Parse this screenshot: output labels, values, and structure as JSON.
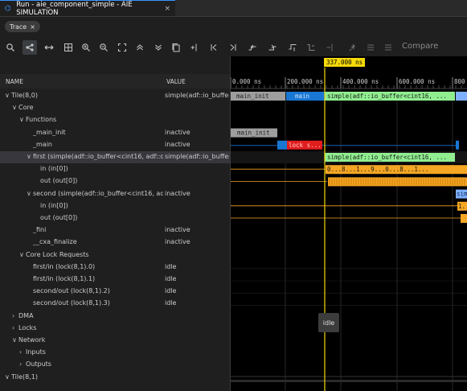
{
  "window": {
    "tab_title": "Run - aie_component_simple - AIE SIMULATION",
    "close_glyph": "×"
  },
  "chip": {
    "label": "Trace",
    "close_glyph": "×"
  },
  "toolbar": {
    "compare_label": "Compare"
  },
  "columns": {
    "name": "NAME",
    "value": "VALUE"
  },
  "tree": [
    {
      "name": "Tile(8,0)",
      "value": "simple(adf::io_buffer",
      "indent": 0,
      "chev": "∨"
    },
    {
      "name": "Core",
      "value": "",
      "indent": 1,
      "chev": "∨"
    },
    {
      "name": "Functions",
      "value": "",
      "indent": 2,
      "chev": "∨"
    },
    {
      "name": "_main_init",
      "value": "inactive",
      "indent": 3,
      "chev": ""
    },
    {
      "name": "_main",
      "value": "inactive",
      "indent": 3,
      "chev": ""
    },
    {
      "name": "first (simple(adf::io_buffer<cint16, adf::dire",
      "value": "simple(adf::io_buffer",
      "indent": 3,
      "chev": "∨",
      "selected": true
    },
    {
      "name": "in (in[0])",
      "value": "",
      "indent": 4,
      "chev": ""
    },
    {
      "name": "out (out[0])",
      "value": "",
      "indent": 4,
      "chev": ""
    },
    {
      "name": "second (simple(adf::io_buffer<cint16, adf::",
      "value": "inactive",
      "indent": 3,
      "chev": "∨"
    },
    {
      "name": "in (in[0])",
      "value": "",
      "indent": 4,
      "chev": ""
    },
    {
      "name": "out (out[0])",
      "value": "",
      "indent": 4,
      "chev": ""
    },
    {
      "name": "_fini",
      "value": "inactive",
      "indent": 3,
      "chev": ""
    },
    {
      "name": "__cxa_finalize",
      "value": "inactive",
      "indent": 3,
      "chev": ""
    },
    {
      "name": "Core Lock Requests",
      "value": "",
      "indent": 2,
      "chev": "∨"
    },
    {
      "name": "first/in (lock(8,1).0)",
      "value": "idle",
      "indent": 3,
      "chev": ""
    },
    {
      "name": "first/in (lock(8,1).1)",
      "value": "idle",
      "indent": 3,
      "chev": ""
    },
    {
      "name": "second/out (lock(8,1).2)",
      "value": "idle",
      "indent": 3,
      "chev": ""
    },
    {
      "name": "second/out (lock(8,1).3)",
      "value": "idle",
      "indent": 3,
      "chev": ""
    },
    {
      "name": "DMA",
      "value": "",
      "indent": 1,
      "chev": "›"
    },
    {
      "name": "Locks",
      "value": "",
      "indent": 1,
      "chev": "›"
    },
    {
      "name": "Network",
      "value": "",
      "indent": 1,
      "chev": "∨"
    },
    {
      "name": "Inputs",
      "value": "",
      "indent": 2,
      "chev": "›"
    },
    {
      "name": "Outputs",
      "value": "",
      "indent": 2,
      "chev": "›"
    },
    {
      "name": "Tile(8,1)",
      "value": "",
      "indent": 0,
      "chev": "∨"
    }
  ],
  "timeline": {
    "cursor_label": "337.000 ns",
    "ticks": [
      "0.000 ns",
      "200.000 ns",
      "400.000 ns",
      "600.000 ns",
      "800"
    ],
    "labels": {
      "main_init": "main_init",
      "main": "main",
      "simple": "simple(adf::io_buffer<cint16, ...",
      "lock": "lock s...",
      "in_data": "0...8...1...9...0...8...1...",
      "sim_short": "sim",
      "out_short": "1."
    },
    "hover_tooltip": "idle"
  },
  "colors": {
    "accent": "#3794ff",
    "cursor": "#f5d90a",
    "green": "#90ee90",
    "orange": "#f5a623",
    "blue": "#1976d2",
    "red": "#e11d1d",
    "gray": "#9e9e9e"
  }
}
